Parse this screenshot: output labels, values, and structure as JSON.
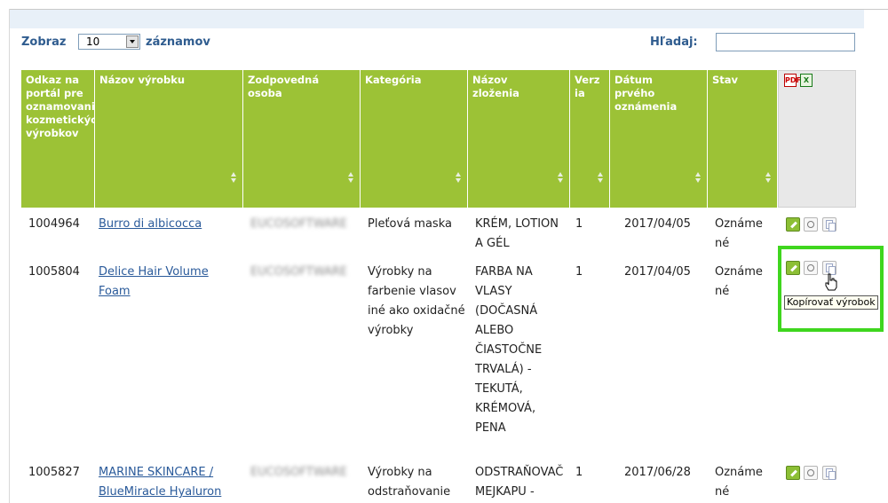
{
  "controls": {
    "show_label": "Zobraz",
    "page_size": "10",
    "records_label": "záznamov",
    "search_label": "Hľadaj:",
    "search_value": ""
  },
  "table": {
    "headers": [
      "Odkaz na portál pre oznamovanie kozmetických výrobkov",
      "Názov výrobku",
      "Zodpovedná osoba",
      "Kategória",
      "Názov zloženia",
      "Verzia",
      "Dátum prvého oznámenia",
      "Stav"
    ],
    "export_icons": [
      "pdf-export-icon",
      "excel-export-icon"
    ],
    "rows": [
      {
        "ref": "1004964",
        "name": "Burro di albicocca",
        "person": "EUCOSOFTWARE",
        "category": "Pleťová maska",
        "formulation": "KRÉM, LOTION A GÉL",
        "version": "1",
        "date": "2017/04/05",
        "status": "Oznámené"
      },
      {
        "ref": "1005804",
        "name": "Delice Hair Volume Foam",
        "person": "EUCOSOFTWARE",
        "category": "Výrobky na farbenie vlasov iné ako oxidačné výrobky",
        "formulation": "FARBA NA VLASY (DOČASNÁ ALEBO ČIASTOČNE TRVALÁ) - TEKUTÁ, KRÉMOVÁ, PENA",
        "version": "1",
        "date": "2017/04/05",
        "status": "Oznámené"
      },
      {
        "ref": "1005827",
        "name": "MARINE SKINCARE / BlueMiracle Hyaluron",
        "person": "EUCOSOFTWARE",
        "category": "Výrobky na odstraňovanie",
        "formulation": "ODSTRAŇOVAČ MEJKAPU -",
        "version": "1",
        "date": "2017/06/28",
        "status": "Oznámené"
      }
    ],
    "row_actions": [
      "edit-icon",
      "view-icon",
      "copy-icon"
    ]
  },
  "tooltip": "Kopírovať výrobok",
  "colors": {
    "header_bg": "#9cc236",
    "link": "#2a5a9a",
    "label_blue": "#2f5c8f",
    "highlight": "#3fd61e"
  }
}
